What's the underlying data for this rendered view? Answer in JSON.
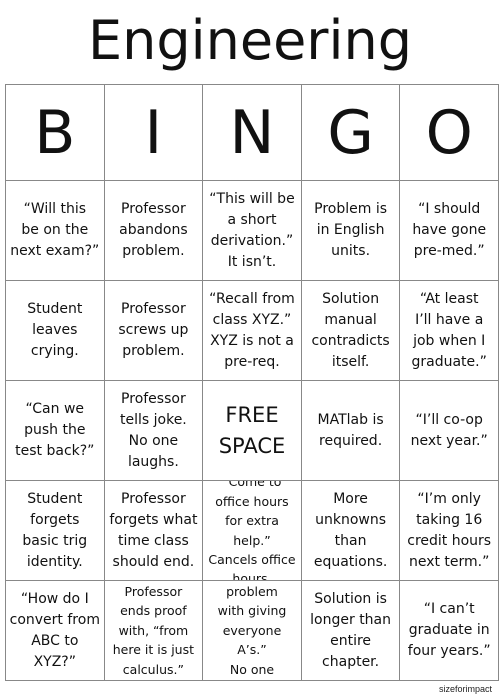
{
  "title": "Engineering",
  "headers": [
    "B",
    "I",
    "N",
    "G",
    "O"
  ],
  "cells": [
    "“Will this\nbe on the\nnext exam?”",
    "Professor\nabandons\nproblem.",
    "“This will be\na short\nderivation.”\nIt isn’t.",
    "Problem is\nin English\nunits.",
    "“I should\nhave gone\npre-med.”",
    "Student\nleaves\ncrying.",
    "Professor\nscrews up\nproblem.",
    "“Recall from\nclass XYZ.”\nXYZ is not a\npre-req.",
    "Solution\nmanual\ncontradicts\nitself.",
    "“At least\nI’ll have a\njob when I\ngraduate.”",
    "“Can we\npush the\ntest back?”",
    "Professor\ntells joke.\nNo one\nlaughs.",
    "FREE\nSPACE",
    "MATlab is\nrequired.",
    "“I’ll co-op\nnext year.”",
    "Student\nforgets\nbasic trig\nidentity.",
    "Professor\nforgets what\ntime class\nshould end.",
    "“Come to\noffice hours\nfor extra help.”\nCancels office\nhours.",
    "More\nunknowns\nthan\nequations.",
    "“I’m only\ntaking 16\ncredit hours\nnext term.”",
    "“How do I\nconvert from\nABC to XYZ?”",
    "Professor\nends proof\nwith, “from\nhere it is just\ncalculus.”",
    "“I have no\nproblem\nwith giving\neveryone A’s.”\nNo one passes.",
    "Solution is\nlonger than\nentire\nchapter.",
    "“I can’t\ngraduate in\nfour years.”"
  ],
  "credit": "sizeforimpact"
}
